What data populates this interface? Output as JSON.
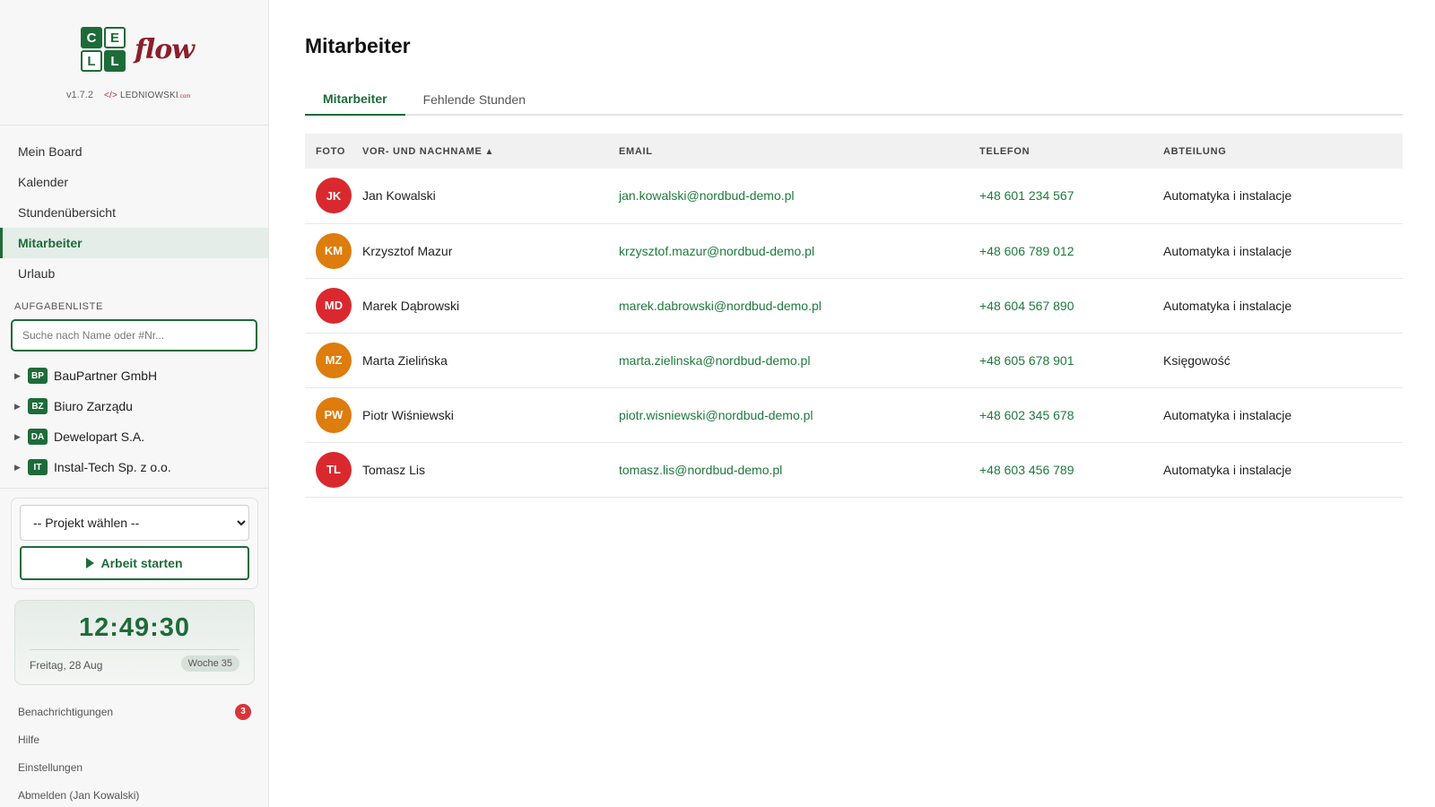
{
  "app": {
    "logo_letters": [
      "C",
      "E",
      "L",
      "L"
    ],
    "logo_word": "flow",
    "version": "v1.7.2",
    "vendor_tag": "</>",
    "vendor_name": "LEDNIOWSKI",
    "vendor_tld": ".com"
  },
  "sidebar": {
    "nav": [
      {
        "label": "Mein Board",
        "active": false
      },
      {
        "label": "Kalender",
        "active": false
      },
      {
        "label": "Stundenübersicht",
        "active": false
      },
      {
        "label": "Mitarbeiter",
        "active": true
      },
      {
        "label": "Urlaub",
        "active": false
      }
    ],
    "tasks_label": "AUFGABENLISTE",
    "search_placeholder": "Suche nach Name oder #Nr...",
    "tasks": [
      {
        "badge": "BP",
        "name": "BauPartner GmbH"
      },
      {
        "badge": "BZ",
        "name": "Biuro Zarządu"
      },
      {
        "badge": "DA",
        "name": "Dewelopart S.A."
      },
      {
        "badge": "IT",
        "name": "Instal-Tech Sp. z o.o."
      }
    ],
    "project_select": "-- Projekt wählen --",
    "start_button": "Arbeit starten",
    "clock": {
      "time": "12:49:30",
      "date": "Freitag, 28 Aug",
      "week": "Woche 35"
    },
    "footer": {
      "notifications": "Benachrichtigungen",
      "notifications_count": "3",
      "help": "Hilfe",
      "settings": "Einstellungen",
      "logout": "Abmelden (Jan Kowalski)"
    }
  },
  "main": {
    "title": "Mitarbeiter",
    "tabs": [
      {
        "label": "Mitarbeiter",
        "active": true
      },
      {
        "label": "Fehlende Stunden",
        "active": false
      }
    ],
    "columns": {
      "photo": "FOTO",
      "name": "VOR- UND NACHNAME",
      "sort_indicator": "▲",
      "email": "EMAIL",
      "phone": "TELEFON",
      "department": "ABTEILUNG"
    },
    "rows": [
      {
        "initials": "JK",
        "color": "#d9292f",
        "name": "Jan Kowalski",
        "email": "jan.kowalski@nordbud-demo.pl",
        "phone": "+48 601 234 567",
        "department": "Automatyka i instalacje"
      },
      {
        "initials": "KM",
        "color": "#de7c0d",
        "name": "Krzysztof Mazur",
        "email": "krzysztof.mazur@nordbud-demo.pl",
        "phone": "+48 606 789 012",
        "department": "Automatyka i instalacje"
      },
      {
        "initials": "MD",
        "color": "#d9292f",
        "name": "Marek Dąbrowski",
        "email": "marek.dabrowski@nordbud-demo.pl",
        "phone": "+48 604 567 890",
        "department": "Automatyka i instalacje"
      },
      {
        "initials": "MZ",
        "color": "#de7c0d",
        "name": "Marta Zielińska",
        "email": "marta.zielinska@nordbud-demo.pl",
        "phone": "+48 605 678 901",
        "department": "Księgowość"
      },
      {
        "initials": "PW",
        "color": "#de7c0d",
        "name": "Piotr Wiśniewski",
        "email": "piotr.wisniewski@nordbud-demo.pl",
        "phone": "+48 602 345 678",
        "department": "Automatyka i instalacje"
      },
      {
        "initials": "TL",
        "color": "#d9292f",
        "name": "Tomasz Lis",
        "email": "tomasz.lis@nordbud-demo.pl",
        "phone": "+48 603 456 789",
        "department": "Automatyka i instalacje"
      }
    ]
  },
  "colors": {
    "brand_green": "#1e6b3a",
    "logo_red": "#8b1f2a",
    "badge_red": "#d9353b"
  }
}
